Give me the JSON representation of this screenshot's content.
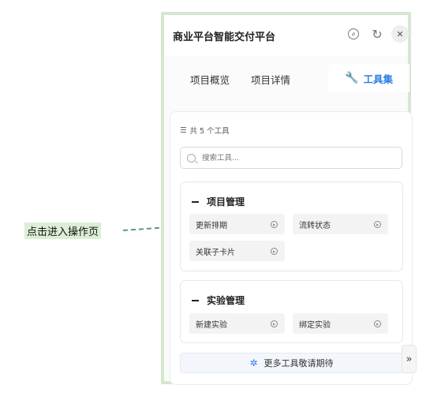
{
  "annotation": {
    "label": "点击进入操作页"
  },
  "panel": {
    "title": "商业平台智能交付平台",
    "tabs": [
      {
        "label": "项目概览"
      },
      {
        "label": "项目详情"
      },
      {
        "label": "工具集",
        "active": true
      }
    ],
    "tool_count": "共 5 个工具",
    "search_placeholder": "搜索工具...",
    "groups": [
      {
        "title": "项目管理",
        "tools": [
          {
            "label": "更新排期"
          },
          {
            "label": "流转状态"
          },
          {
            "label": "关联子卡片"
          }
        ]
      },
      {
        "title": "实验管理",
        "tools": [
          {
            "label": "新建实验"
          },
          {
            "label": "绑定实验"
          }
        ]
      }
    ],
    "more_label": "更多工具敬请期待",
    "expand_glyph": "»"
  },
  "colors": {
    "accent": "#2d7fe3",
    "panel_border": "#d4e7cf",
    "callout_bg": "#dbeed6"
  },
  "icons": [
    "compass-icon",
    "refresh-icon",
    "close-icon",
    "wrench-icon",
    "filter-icon",
    "search-icon",
    "play-icon",
    "sparkle-icon",
    "chevron-double-right-icon"
  ]
}
